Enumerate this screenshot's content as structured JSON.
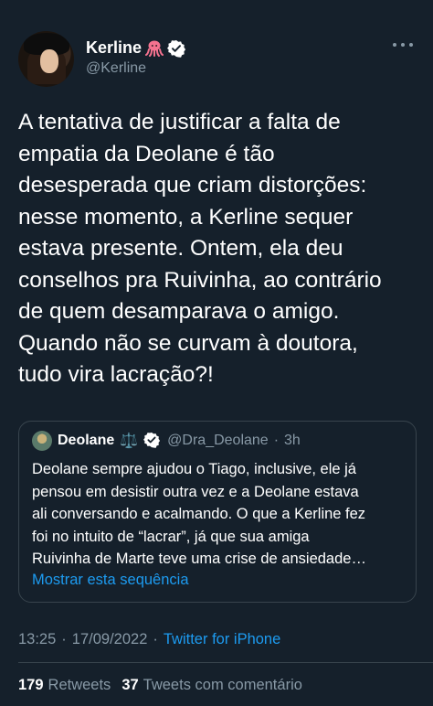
{
  "author": {
    "name": "Kerline",
    "handle": "@Kerline",
    "emoji": "octopus-icon",
    "verified": true
  },
  "tweet": {
    "text": "A tentativa de justificar a falta de\nempatia da Deolane é tão\ndesesperada que criam distorções:\nnesse momento, a Kerline sequer\nestava presente. Ontem, ela deu\nconselhos pra Ruivinha, ao contrário\nde quem desamparava o amigo.\nQuando não se curvam à doutora,\ntudo vira lacração?!"
  },
  "quote": {
    "name": "Deolane",
    "name_emoji": "⚖️",
    "handle": "@Dra_Deolane",
    "separator": "·",
    "time": "3h",
    "text": "Deolane sempre ajudou o Tiago, inclusive, ele já\npensou em desistir outra vez e a Deolane estava\nali conversando e acalmando. O que a Kerline fez\nfoi no intuito de “lacrar”, já que sua amiga\nRuivinha de Marte teve uma crise de ansiedade…",
    "show_thread": "Mostrar esta sequência"
  },
  "meta": {
    "time": "13:25",
    "dot1": "·",
    "date": "17/09/2022",
    "dot2": "·",
    "source": "Twitter for iPhone"
  },
  "stats": {
    "retweets_count": "179",
    "retweets_label": "Retweets",
    "quotes_count": "37",
    "quotes_label": "Tweets com comentário"
  },
  "colors": {
    "background": "#15202b",
    "secondary_text": "#8899a6",
    "link": "#1d9bf0",
    "border": "#38444d"
  }
}
